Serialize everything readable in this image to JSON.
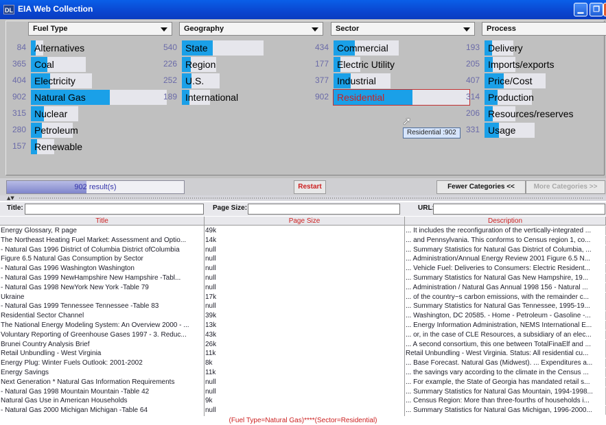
{
  "window": {
    "icon": "DL",
    "title": "EIA Web Collection",
    "controls": {
      "minimize": "▁",
      "maximize": "❐",
      "close": "×"
    }
  },
  "panel": {
    "columns": [
      {
        "name": "Fuel Type",
        "items": [
          {
            "count": "84",
            "label": "Alternatives",
            "value": 84
          },
          {
            "count": "365",
            "label": "Coal",
            "value": 365
          },
          {
            "count": "404",
            "label": "Electricity",
            "value": 404
          },
          {
            "count": "902",
            "label": "Natural Gas",
            "value": 902
          },
          {
            "count": "315",
            "label": "Nuclear",
            "value": 315
          },
          {
            "count": "280",
            "label": "Petroleum",
            "value": 280
          },
          {
            "count": "157",
            "label": "Renewable",
            "value": 157
          }
        ]
      },
      {
        "name": "Geography",
        "items": [
          {
            "count": "540",
            "label": "State",
            "value": 540
          },
          {
            "count": "226",
            "label": "Region",
            "value": 226
          },
          {
            "count": "252",
            "label": "U.S.",
            "value": 252
          },
          {
            "count": "189",
            "label": "International",
            "value": 189
          }
        ]
      },
      {
        "name": "Sector",
        "items": [
          {
            "count": "434",
            "label": "Commercial",
            "value": 434
          },
          {
            "count": "177",
            "label": "Electric Utility",
            "value": 177
          },
          {
            "count": "377",
            "label": "Industrial",
            "value": 377
          },
          {
            "count": "902",
            "label": "Residential",
            "value": 902,
            "selected": true
          }
        ]
      },
      {
        "name": "Process",
        "items": [
          {
            "count": "193",
            "label": "Delivery",
            "value": 193
          },
          {
            "count": "205",
            "label": "Imports/exports",
            "value": 205
          },
          {
            "count": "407",
            "label": "Price/Cost",
            "value": 407
          },
          {
            "count": "314",
            "label": "Production",
            "value": 314
          },
          {
            "count": "206",
            "label": "Resources/reserves",
            "value": 206
          },
          {
            "count": "331",
            "label": "Usage",
            "value": 331
          }
        ]
      }
    ],
    "tooltip": "Residential :902"
  },
  "controls": {
    "result_text": "902 result(s)",
    "result_fraction": 0.45,
    "restart": "Restart",
    "fewer": "Fewer Categories <<",
    "more": "More Categories >>"
  },
  "search": {
    "title_label": "Title:",
    "page_size_label": "Page Size:",
    "url_label": "URL:",
    "title_value": "",
    "page_size_value": "",
    "url_value": ""
  },
  "table": {
    "headers": [
      "Title",
      "Page Size",
      "Description"
    ],
    "rows": [
      [
        "Energy Glossary, R page",
        "49k",
        "... It includes the reconfiguration of the vertically-integrated ..."
      ],
      [
        "The Northeast Heating Fuel Market: Assessment and Optio...",
        "14k",
        "... and Pennsylvania. This conforms to Census region 1, co..."
      ],
      [
        "- Natural Gas 1996 District of Columbia District ofColumbia",
        "null",
        "... Summary Statistics for Natural Gas District of Columbia, ..."
      ],
      [
        "Figure 6.5 Natural Gas Consumption by Sector",
        "null",
        "... Administration/Annual Energy Review 2001 Figure 6.5 N..."
      ],
      [
        "- Natural Gas 1996 Washington Washington",
        "null",
        "... Vehicle Fuel: Deliveries to Consumers: Electric Resident..."
      ],
      [
        "- Natural Gas 1999 NewHampshire New Hampshire -Tabl...",
        "null",
        "... Summary Statistics for Natural Gas New Hampshire, 19..."
      ],
      [
        "- Natural Gas 1998 NewYork New York -Table 79",
        "null",
        "... Administration / Natural Gas Annual 1998 156 - Natural ..."
      ],
      [
        "Ukraine",
        "17k",
        "... of the country~s carbon emissions, with the remainder c..."
      ],
      [
        "- Natural Gas 1999 Tennessee Tennessee -Table 83",
        "null",
        "... Summary Statistics for Natural Gas Tennessee, 1995-19..."
      ],
      [
        "Residential Sector Channel",
        "39k",
        "... Washington, DC 20585. - Home - Petroleum - Gasoline -..."
      ],
      [
        "The National Energy Modeling System: An Overview 2000 - ...",
        "13k",
        "... Energy Information Administration, NEMS International E..."
      ],
      [
        "Voluntary Reporting of Greenhouse Gases 1997 - 3. Reduc...",
        "43k",
        "... or, in the case of CLE Resources, a subsidiary of an elec..."
      ],
      [
        "Brunei Country Analysis Brief",
        "26k",
        "... A second consortium, this one between TotalFinaElf and ..."
      ],
      [
        "Retail Unbundling - West Virginia",
        "11k",
        "Retail Unbundling - West Virginia. Status: All residential cu..."
      ],
      [
        "Energy Plug: Winter Fuels Outlook: 2001-2002",
        "8k",
        "... Base Forecast. Natural Gas (Midwest). ... Expenditures a..."
      ],
      [
        "Energy Savings",
        "11k",
        "... the savings vary according to the climate in the Census ..."
      ],
      [
        "Next Generation * Natural Gas Information Requirements",
        "null",
        "... For example, the State of Georgia has mandated retail s..."
      ],
      [
        "- Natural Gas 1998 Mountain Mountain -Table 42",
        "null",
        "... Summary Statistics for Natural Gas Mountain, 1994-1998..."
      ],
      [
        "Natural Gas Use in American Households",
        "9k",
        "... Census Region: More than three-fourths of households i..."
      ],
      [
        "- Natural Gas 2000 Michigan Michigan -Table 64",
        "null",
        "... Summary Statistics for Natural Gas Michigan, 1996-2000..."
      ]
    ]
  },
  "status": "(Fuel Type=Natural Gas)****(Sector=Residential)",
  "colors": {
    "bar_fill": "#1aa0e8",
    "selected": "#cc2020",
    "panel_bg": "#c0c0c0"
  }
}
